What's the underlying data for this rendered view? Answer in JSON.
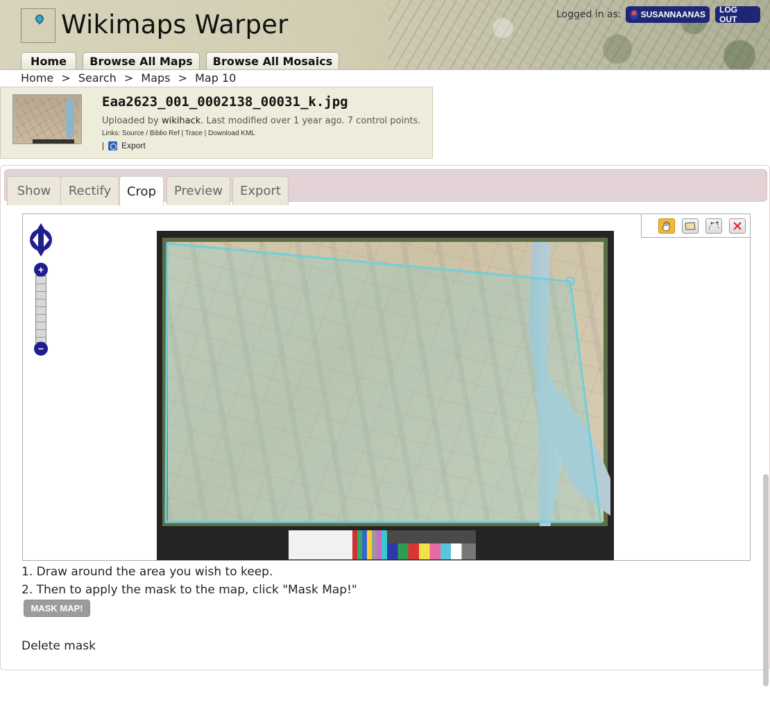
{
  "header": {
    "site_title": "Wikimaps Warper",
    "login_label": "Logged in as:",
    "username": "SUSANNAANAS",
    "logout_label": "LOG OUT",
    "nav": [
      "Home",
      "Browse All Maps",
      "Browse All Mosaics"
    ]
  },
  "breadcrumb": [
    "Home",
    ">",
    "Search",
    ">",
    "Maps",
    ">",
    "Map 10"
  ],
  "map_info": {
    "filename": "Eaa2623_001_0002138_00031_k.jpg",
    "uploaded_prefix": "Uploaded by",
    "uploader": "wikihack",
    "uploaded_suffix": ". Last modified over 1 year ago. 7 control points.",
    "links": "Links: Source / Biblio Ref | Trace | Download KML",
    "export_prefix": "|",
    "export_label": "Export"
  },
  "tabs": [
    {
      "label": "Show",
      "active": false
    },
    {
      "label": "Rectify",
      "active": false
    },
    {
      "label": "Crop",
      "active": true
    },
    {
      "label": "Preview",
      "active": false
    },
    {
      "label": "Export",
      "active": false
    }
  ],
  "map_tools": {
    "pan": "hand-icon",
    "draw_polygon": "polygon-icon",
    "modify": "modify-icon",
    "delete": "delete-icon",
    "zoom_in": "+",
    "zoom_out": "−"
  },
  "instructions": {
    "step1": "1. Draw around the area you wish to keep.",
    "step2": "2. Then to apply the mask to the map, click \"Mask Map!\"",
    "mask_button": "MASK MAP!",
    "delete_mask": "Delete mask"
  },
  "colors": {
    "accent_dark_blue": "#1d2775",
    "mask_line": "#6fd0d8",
    "tab_bar": "#e3d2d6",
    "info_bg": "#eeeddc"
  }
}
